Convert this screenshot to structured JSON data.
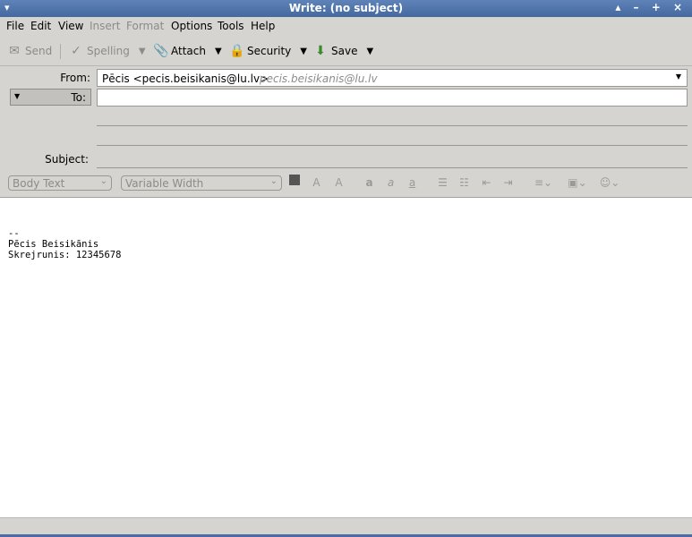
{
  "window": {
    "title": "Write: (no subject)",
    "controls": "▴ – + ×"
  },
  "menu": {
    "file": "File",
    "edit": "Edit",
    "view": "View",
    "insert": "Insert",
    "format": "Format",
    "options": "Options",
    "tools": "Tools",
    "help": "Help"
  },
  "toolbar": {
    "send": "Send",
    "spelling": "Spelling",
    "attach": "Attach",
    "security": "Security",
    "save": "Save"
  },
  "header": {
    "from_label": "From:",
    "from_value": "Pēcis <pecis.beisikanis@lu.lv>",
    "from_alias": "pecis.beisikanis@lu.lv",
    "to_label": "To:",
    "to_value": "",
    "subject_label": "Subject:",
    "subject_value": ""
  },
  "format": {
    "paragraph_style": "Body Text",
    "font": "Variable Width"
  },
  "body": {
    "text": "--\nPēcis Beisikānis\nSkrejrunis: 12345678"
  },
  "colors": {
    "titlebar": "#4a6ea3",
    "chrome": "#d6d4d0"
  }
}
